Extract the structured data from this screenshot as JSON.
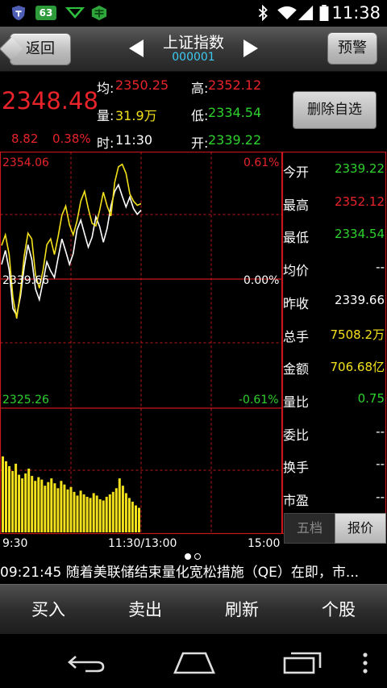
{
  "status_bar": {
    "time": "11:38",
    "notification_badge": "63",
    "icons": [
      "shield-app-icon",
      "badge-63-icon",
      "chevron-app-icon",
      "green-cube-app-icon",
      "bluetooth-icon",
      "wifi-icon",
      "signal-icon",
      "battery-icon"
    ]
  },
  "title_bar": {
    "back_label": "返回",
    "stock_name": "上证指数",
    "stock_code": "000001",
    "alert_label": "预警"
  },
  "quote": {
    "price": "2348.48",
    "change": "8.82",
    "change_pct": "0.38%",
    "avg_label": "均:",
    "avg_value": "2350.25",
    "volume_label": "量:",
    "volume_value": "31.9万",
    "time_label": "时:",
    "time_value": "11:30",
    "high_label": "高:",
    "high_value": "2352.12",
    "low_label": "低:",
    "low_value": "2334.54",
    "open_label": "开:",
    "open_value": "2339.22",
    "remove_watch_label": "删除自选"
  },
  "chart_data": {
    "type": "line",
    "title": "",
    "y_axis_left": {
      "top": "2354.06",
      "mid": "2339.66",
      "bottom": "2325.26"
    },
    "y_axis_right": {
      "top": "0.61%",
      "mid": "0.00%",
      "bottom": "-0.61%"
    },
    "ylim": [
      2325.26,
      2354.06
    ],
    "x_ticks": [
      "9:30",
      "11:30/13:00",
      "15:00"
    ],
    "series": [
      {
        "color": "#ffffff",
        "values": [
          2341.5,
          2343.2,
          2340.8,
          2336.1,
          2335.3,
          2337.6,
          2341.2,
          2343.9,
          2342.1,
          2338.5,
          2337.2,
          2339.4,
          2341.8,
          2340.7,
          2339.9,
          2342.3,
          2344.6,
          2343.1,
          2341.5,
          2342.8,
          2345.7,
          2346.9,
          2345.2,
          2343.6,
          2344.8,
          2347.3,
          2346.1,
          2344.2,
          2345.9,
          2348.6,
          2350.4,
          2351.2,
          2349.8,
          2348.5,
          2349.7,
          2348.3,
          2347.6,
          2348.1
        ]
      },
      {
        "color": "#f3e21b",
        "values": [
          2343.8,
          2345.1,
          2342.7,
          2337.5,
          2334.9,
          2338.2,
          2342.6,
          2345.3,
          2344.6,
          2340.2,
          2338.6,
          2340.8,
          2343.9,
          2344.6,
          2342.7,
          2344.9,
          2347.5,
          2348.6,
          2346.3,
          2345.1,
          2346.8,
          2349.2,
          2350.4,
          2348.3,
          2346.5,
          2346.2,
          2348.1,
          2350.3,
          2348.6,
          2347.4,
          2351.5,
          2353.4,
          2353.7,
          2352.6,
          2350.1,
          2349.2,
          2348.7,
          2348.9
        ]
      }
    ],
    "volume": {
      "color": "#f3e21b",
      "values": [
        0.62,
        0.58,
        0.54,
        0.5,
        0.56,
        0.47,
        0.44,
        0.48,
        0.52,
        0.46,
        0.42,
        0.45,
        0.43,
        0.38,
        0.41,
        0.44,
        0.4,
        0.36,
        0.42,
        0.39,
        0.35,
        0.37,
        0.33,
        0.3,
        0.34,
        0.31,
        0.29,
        0.28,
        0.32,
        0.3,
        0.27,
        0.26,
        0.29,
        0.31,
        0.33,
        0.36,
        0.44,
        0.38,
        0.32,
        0.28,
        0.25,
        0.22,
        0.2
      ]
    }
  },
  "side_panel": [
    {
      "key": "今开",
      "value": "2339.22",
      "color": "#2ed12e"
    },
    {
      "key": "最高",
      "value": "2352.12",
      "color": "#e8232a"
    },
    {
      "key": "最低",
      "value": "2334.54",
      "color": "#2ed12e"
    },
    {
      "key": "均价",
      "value": "--",
      "color": "#ffffff"
    },
    {
      "key": "昨收",
      "value": "2339.66",
      "color": "#ffffff"
    },
    {
      "key": "总手",
      "value": "7508.2万",
      "color": "#f3e21b"
    },
    {
      "key": "金额",
      "value": "706.68亿",
      "color": "#f3e21b"
    },
    {
      "key": "量比",
      "value": "0.75",
      "color": "#2ed12e"
    },
    {
      "key": "委比",
      "value": "--",
      "color": "#ffffff"
    },
    {
      "key": "换手",
      "value": "--",
      "color": "#ffffff"
    },
    {
      "key": "市盈",
      "value": "--",
      "color": "#ffffff"
    }
  ],
  "side_tabs": {
    "tab1": "五档",
    "tab2": "报价"
  },
  "ticker": "09:21:45 随着美联储结束量化宽松措施（QE）在即，市...",
  "menu": {
    "buy": "买入",
    "sell": "卖出",
    "refresh": "刷新",
    "stock": "个股"
  },
  "colors": {
    "up": "#e8232a",
    "down": "#2ed12e",
    "grid": "#c8161d",
    "accent": "#3ec9f2"
  }
}
